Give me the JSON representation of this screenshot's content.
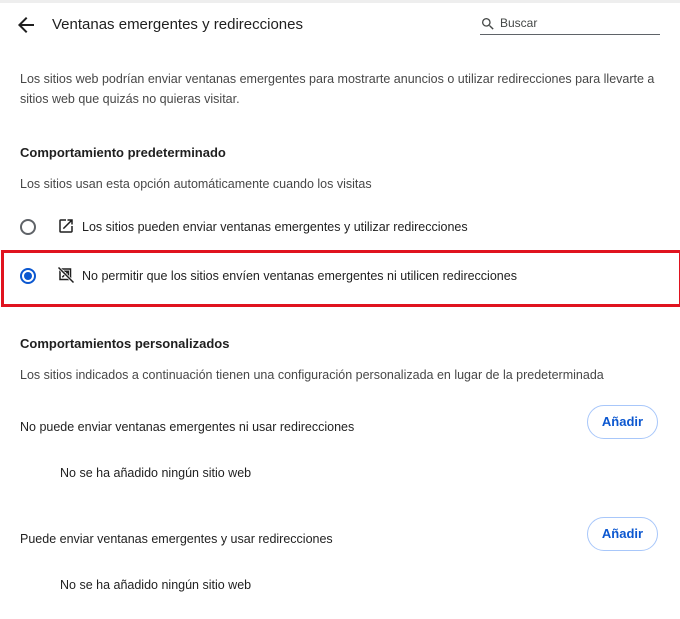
{
  "header": {
    "title": "Ventanas emergentes y redirecciones",
    "search_placeholder": "Buscar"
  },
  "description": "Los sitios web podrían enviar ventanas emergentes para mostrarte anuncios o utilizar redirecciones para llevarte a sitios web que quizás no quieras visitar.",
  "default_behavior": {
    "title": "Comportamiento predeterminado",
    "subtitle": "Los sitios usan esta opción automáticamente cuando los visitas",
    "options": [
      {
        "label": "Los sitios pueden enviar ventanas emergentes y utilizar redirecciones",
        "icon": "open-in-new-icon",
        "checked": false
      },
      {
        "label": "No permitir que los sitios envíen ventanas emergentes ni utilicen redirecciones",
        "icon": "popups-blocked-icon",
        "checked": true
      }
    ]
  },
  "custom_behaviors": {
    "title": "Comportamientos personalizados",
    "subtitle": "Los sitios indicados a continuación tienen una configuración personalizada en lugar de la predeterminada",
    "lists": [
      {
        "title": "No puede enviar ventanas emergentes ni usar redirecciones",
        "add_label": "Añadir",
        "empty_text": "No se ha añadido ningún sitio web"
      },
      {
        "title": "Puede enviar ventanas emergentes y usar redirecciones",
        "add_label": "Añadir",
        "empty_text": "No se ha añadido ningún sitio web"
      }
    ]
  },
  "colors": {
    "accent": "#0b57d0",
    "highlight_border": "#e0131f"
  }
}
